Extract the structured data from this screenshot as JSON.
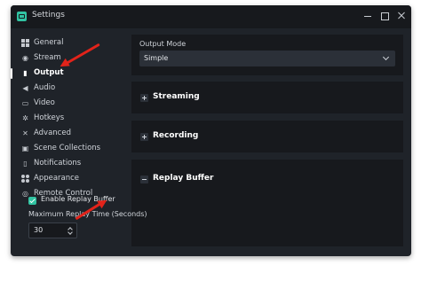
{
  "window": {
    "title": "Settings",
    "icon": "app-logo-icon"
  },
  "sidebar": {
    "items": [
      {
        "label": "General",
        "icon": "grid-icon"
      },
      {
        "label": "Stream",
        "icon": "broadcast-icon"
      },
      {
        "label": "Output",
        "icon": "output-icon",
        "active": true
      },
      {
        "label": "Audio",
        "icon": "speaker-icon"
      },
      {
        "label": "Video",
        "icon": "video-icon"
      },
      {
        "label": "Hotkeys",
        "icon": "gear-icon"
      },
      {
        "label": "Advanced",
        "icon": "tools-icon"
      },
      {
        "label": "Scene Collections",
        "icon": "collections-icon"
      },
      {
        "label": "Notifications",
        "icon": "bell-icon"
      },
      {
        "label": "Appearance",
        "icon": "palette-icon"
      },
      {
        "label": "Remote Control",
        "icon": "remote-icon"
      }
    ]
  },
  "output": {
    "mode_label": "Output Mode",
    "mode_value": "Simple"
  },
  "sections": {
    "streaming": "Streaming",
    "recording": "Recording",
    "replay_buffer": "Replay Buffer"
  },
  "replay": {
    "enable_label": "Enable Replay Buffer",
    "enabled": true,
    "time_label": "Maximum Replay Time (Seconds)",
    "time_value": "30"
  },
  "colors": {
    "accent": "#31c3a2",
    "annotation_arrow": "#e2231a",
    "window_bg": "#1f2329",
    "panel_bg": "#17191d"
  }
}
